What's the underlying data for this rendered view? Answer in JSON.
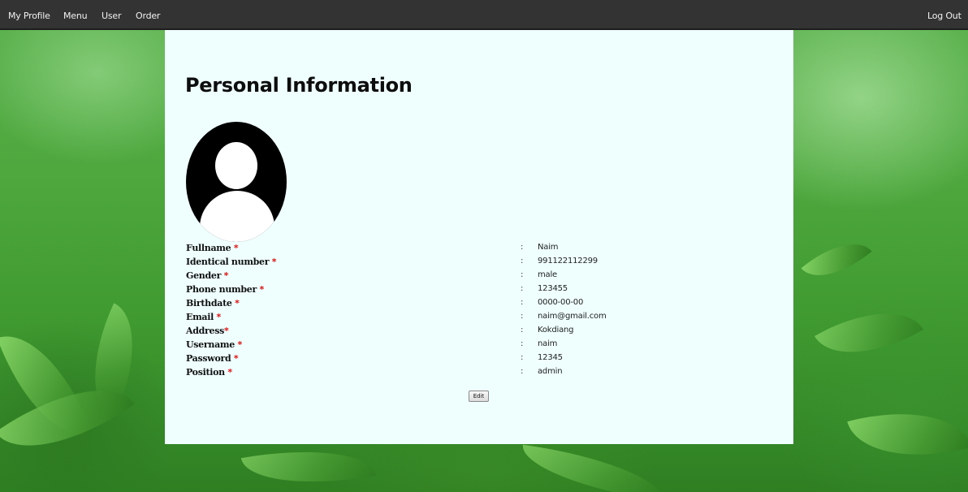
{
  "nav": {
    "items": [
      {
        "label": "My Profile"
      },
      {
        "label": "Menu"
      },
      {
        "label": "User"
      },
      {
        "label": "Order"
      }
    ],
    "logout_label": "Log Out"
  },
  "page": {
    "title": "Personal Information"
  },
  "profile": {
    "required_marker": "*",
    "colon": ":",
    "fields": [
      {
        "label": "Fullname",
        "value": "Naim"
      },
      {
        "label": "Identical number",
        "value": "991122112299"
      },
      {
        "label": "Gender",
        "value": "male"
      },
      {
        "label": "Phone number",
        "value": "123455"
      },
      {
        "label": "Birthdate",
        "value": "0000-00-00"
      },
      {
        "label": "Email",
        "value": "naim@gmail.com"
      },
      {
        "label": "Address",
        "value": "Kokdiang"
      },
      {
        "label": "Username",
        "value": "naim"
      },
      {
        "label": "Password",
        "value": "12345"
      },
      {
        "label": "Position",
        "value": "admin"
      }
    ]
  },
  "actions": {
    "edit_label": "Edit"
  },
  "colors": {
    "navbar": "#333333",
    "panel": "#effffe",
    "required": "#e01010",
    "background": "#4ea83e"
  }
}
